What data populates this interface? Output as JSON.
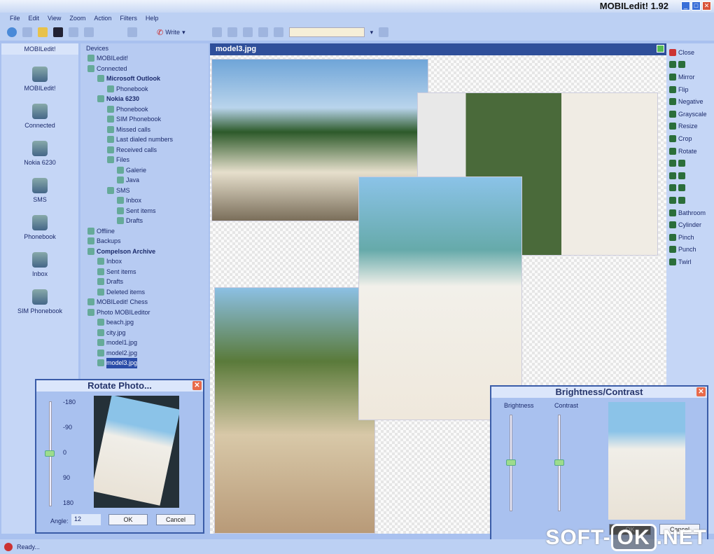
{
  "window": {
    "title": "MOBILedit! 1.92"
  },
  "menu": [
    "File",
    "Edit",
    "View",
    "Zoom",
    "Action",
    "Filters",
    "Help"
  ],
  "toolbar": {
    "write_label": "Write"
  },
  "left_panel": {
    "header": "MOBILedit!",
    "items": [
      "MOBILedit!",
      "Connected",
      "Nokia 6230",
      "SMS",
      "Phonebook",
      "Inbox",
      "SIM Phonebook"
    ]
  },
  "tree": {
    "header": "Devices",
    "nodes": [
      {
        "label": "MOBILedit!",
        "level": 0,
        "bold": false
      },
      {
        "label": "Connected",
        "level": 0,
        "bold": false
      },
      {
        "label": "Microsoft Outlook",
        "level": 1,
        "bold": true
      },
      {
        "label": "Phonebook",
        "level": 2,
        "bold": false
      },
      {
        "label": "Nokia 6230",
        "level": 1,
        "bold": true
      },
      {
        "label": "Phonebook",
        "level": 2,
        "bold": false
      },
      {
        "label": "SIM Phonebook",
        "level": 2,
        "bold": false
      },
      {
        "label": "Missed calls",
        "level": 2,
        "bold": false
      },
      {
        "label": "Last dialed numbers",
        "level": 2,
        "bold": false
      },
      {
        "label": "Received calls",
        "level": 2,
        "bold": false
      },
      {
        "label": "Files",
        "level": 2,
        "bold": false
      },
      {
        "label": "Galerie",
        "level": 3,
        "bold": false
      },
      {
        "label": "Java",
        "level": 3,
        "bold": false
      },
      {
        "label": "SMS",
        "level": 2,
        "bold": false
      },
      {
        "label": "Inbox",
        "level": 3,
        "bold": false
      },
      {
        "label": "Sent items",
        "level": 3,
        "bold": false
      },
      {
        "label": "Drafts",
        "level": 3,
        "bold": false
      },
      {
        "label": "Offline",
        "level": 0,
        "bold": false
      },
      {
        "label": "Backups",
        "level": 0,
        "bold": false
      },
      {
        "label": "Compelson Archive",
        "level": 0,
        "bold": true
      },
      {
        "label": "Inbox",
        "level": 1,
        "bold": false
      },
      {
        "label": "Sent items",
        "level": 1,
        "bold": false
      },
      {
        "label": "Drafts",
        "level": 1,
        "bold": false
      },
      {
        "label": "Deleted items",
        "level": 1,
        "bold": false
      },
      {
        "label": "MOBILedit! Chess",
        "level": 0,
        "bold": false
      },
      {
        "label": "Photo MOBILeditor",
        "level": 0,
        "bold": false
      },
      {
        "label": "beach.jpg",
        "level": 1,
        "bold": false
      },
      {
        "label": "city.jpg",
        "level": 1,
        "bold": false
      },
      {
        "label": "model1.jpg",
        "level": 1,
        "bold": false
      },
      {
        "label": "model2.jpg",
        "level": 1,
        "bold": false
      },
      {
        "label": "model3.jpg",
        "level": 1,
        "bold": false,
        "selected": true
      }
    ]
  },
  "viewer": {
    "title": "model3.jpg"
  },
  "right_tools": [
    "Close",
    "",
    "Mirror",
    "Flip",
    "Negative",
    "Grayscale",
    "Resize",
    "Crop",
    "Rotate",
    "",
    "",
    "",
    "",
    "Bathroom",
    "Cylinder",
    "Pinch",
    "Punch",
    "Twirl"
  ],
  "rotate_dialog": {
    "title": "Rotate Photo...",
    "ticks": [
      "-180",
      "-90",
      "0",
      "90",
      "180"
    ],
    "angle_label": "Angle:",
    "angle_value": "12",
    "ok": "OK",
    "cancel": "Cancel",
    "slider_value": 0
  },
  "bc_dialog": {
    "title": "Brightness/Contrast",
    "brightness_label": "Brightness",
    "contrast_label": "Contrast",
    "ok": "OK",
    "cancel": "Cancel",
    "brightness_value": 0.5,
    "contrast_value": 0.5
  },
  "status": {
    "text": "Ready..."
  },
  "watermark": {
    "a": "SOFT-",
    "b": "OK",
    ".c": ".NET",
    "c": ".NET"
  }
}
